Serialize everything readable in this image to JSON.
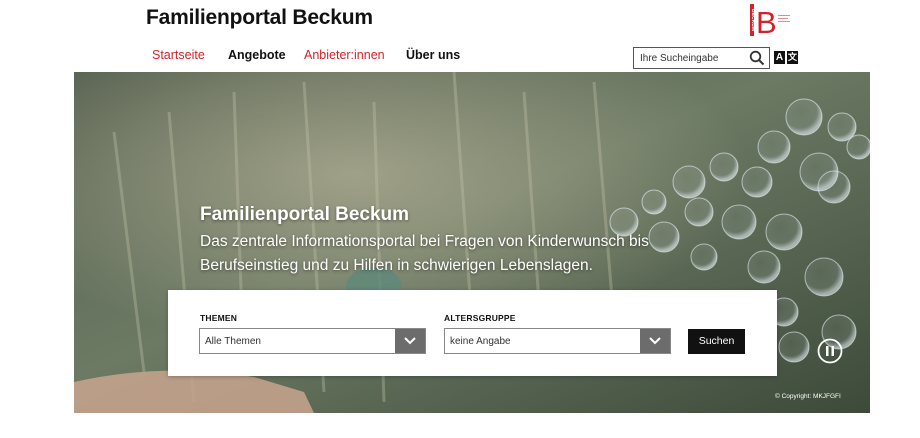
{
  "header": {
    "site_title": "Familienportal Beckum",
    "logo_text": "BECKUM",
    "logo_letter": "B"
  },
  "nav": {
    "items": [
      {
        "label": "Startseite",
        "color": "#d2232a",
        "active": true
      },
      {
        "label": "Angebote",
        "color": "#111111",
        "active": false
      },
      {
        "label": "Anbieter:innen",
        "color": "#d2232a",
        "active": false
      },
      {
        "label": "Über uns",
        "color": "#111111",
        "active": false
      }
    ]
  },
  "search": {
    "placeholder": "Ihre Sucheingabe",
    "icon": "search-icon"
  },
  "language_toggle": {
    "label_a": "A",
    "label_b": "文",
    "icon": "translate-icon"
  },
  "hero": {
    "title": "Familienportal Beckum",
    "subtitle": "Das zentrale Informationsportal bei Fragen von Kinderwunsch bis Berufseinstieg und zu Hilfen in schwierigen Lebenslagen.",
    "copyright": "© Copyright: MKJFGFI",
    "pause_icon": "pause-icon"
  },
  "filters": {
    "themen": {
      "label": "THEMEN",
      "value": "Alle Themen"
    },
    "altersgruppe": {
      "label": "ALTERSGRUPPE",
      "value": "keine Angabe"
    },
    "submit_label": "Suchen"
  },
  "colors": {
    "accent_red": "#d2232a",
    "text": "#111111",
    "select_arrow_bg": "#6c6c6c",
    "button_bg": "#111111"
  }
}
